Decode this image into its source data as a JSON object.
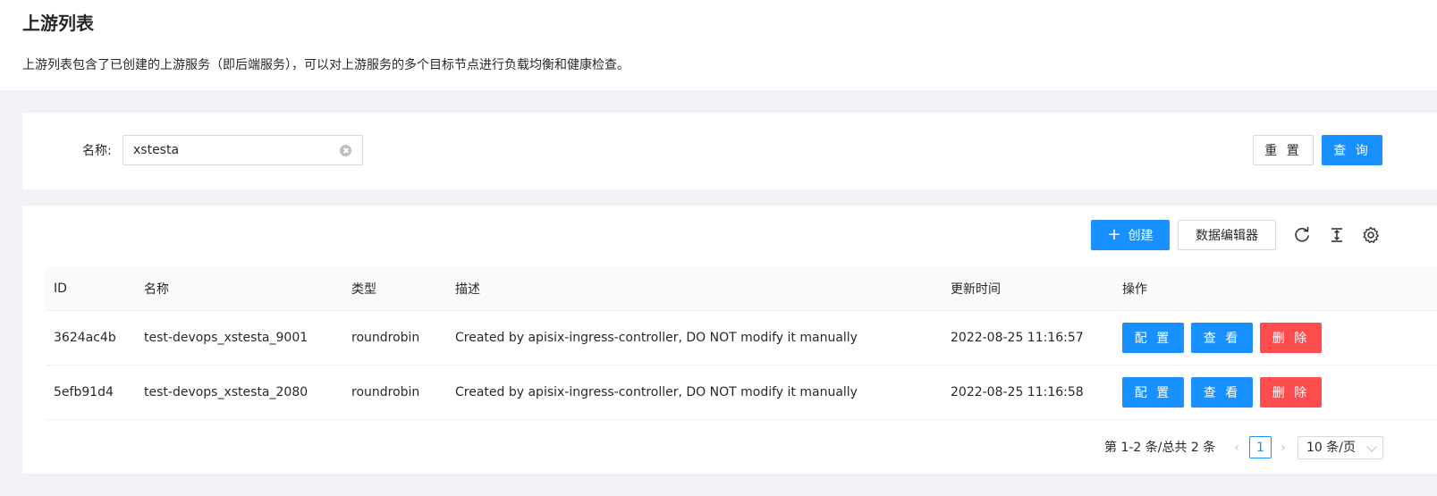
{
  "header": {
    "title": "上游列表",
    "description": "上游列表包含了已创建的上游服务（即后端服务），可以对上游服务的多个目标节点进行负载均衡和健康检查。"
  },
  "search": {
    "name_label": "名称:",
    "name_value": "xstesta",
    "reset_label": "重 置",
    "query_label": "查 询"
  },
  "toolbar": {
    "create_label": "创建",
    "editor_label": "数据编辑器",
    "icons": [
      "reload-icon",
      "column-height-icon",
      "setting-icon"
    ]
  },
  "table": {
    "columns": [
      "ID",
      "名称",
      "类型",
      "描述",
      "更新时间",
      "操作"
    ],
    "rows": [
      {
        "id": "3624ac4b",
        "name": "test-devops_xstesta_9001",
        "type": "roundrobin",
        "desc": "Created by apisix-ingress-controller, DO NOT modify it manually",
        "updated": "2022-08-25 11:16:57"
      },
      {
        "id": "5efb91d4",
        "name": "test-devops_xstesta_2080",
        "type": "roundrobin",
        "desc": "Created by apisix-ingress-controller, DO NOT modify it manually",
        "updated": "2022-08-25 11:16:58"
      }
    ],
    "actions": {
      "config": "配 置",
      "view": "查 看",
      "delete": "删 除"
    }
  },
  "pagination": {
    "total_text": "第 1-2 条/总共 2 条",
    "current_page": "1",
    "page_size": "10 条/页"
  },
  "colors": {
    "primary": "#1890ff",
    "danger": "#ff4d4f",
    "background": "#f0f2f5"
  }
}
